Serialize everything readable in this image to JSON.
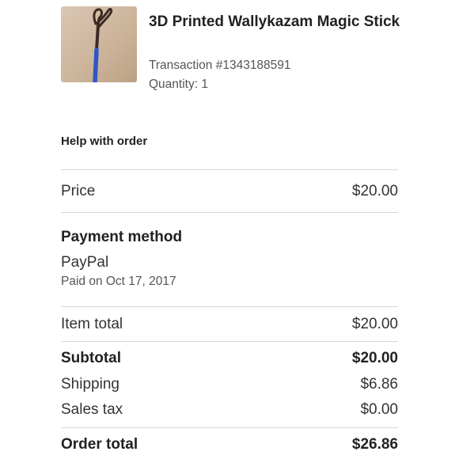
{
  "product": {
    "title": "3D Printed Wallykazam Magic Stick",
    "transaction": "Transaction #1343188591",
    "quantity": "Quantity: 1",
    "image_icon": "magic-stick-photo"
  },
  "help_link": "Help with order",
  "price": {
    "label": "Price",
    "value": "$20.00"
  },
  "payment": {
    "heading": "Payment method",
    "method": "PayPal",
    "paid_on": "Paid on Oct 17, 2017"
  },
  "summary": {
    "item_total": {
      "label": "Item total",
      "value": "$20.00"
    },
    "subtotal": {
      "label": "Subtotal",
      "value": "$20.00"
    },
    "shipping": {
      "label": "Shipping",
      "value": "$6.86"
    },
    "sales_tax": {
      "label": "Sales tax",
      "value": "$0.00"
    },
    "order_total": {
      "label": "Order total",
      "value": "$26.86"
    }
  },
  "colors": {
    "text": "#222222",
    "muted": "#555555",
    "divider": "#d8d8d8",
    "stick_blue": "#2f56c8"
  }
}
